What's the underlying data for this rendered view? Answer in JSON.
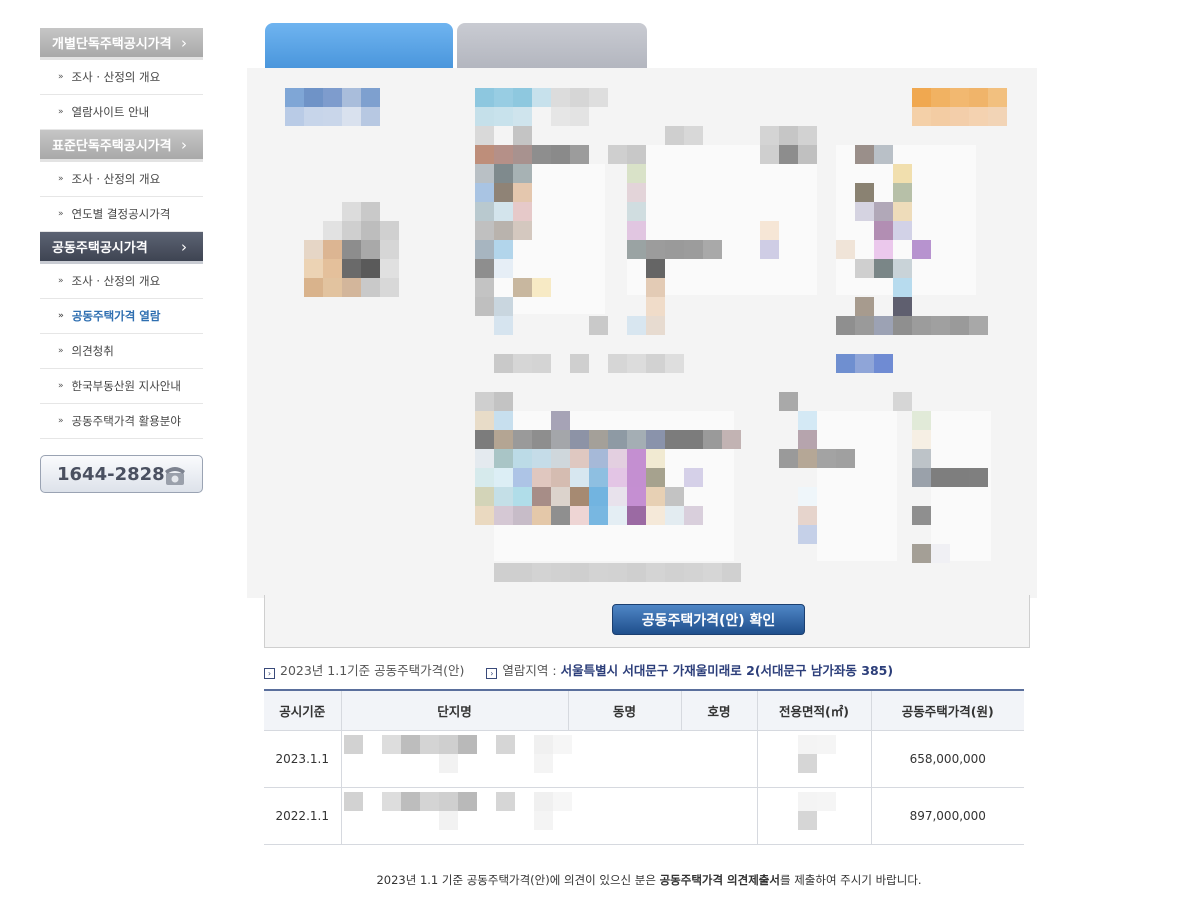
{
  "sidebar": {
    "sections": [
      {
        "title": "개별단독주택공시가격",
        "items": [
          "조사 · 산정의 개요",
          "열람사이트 안내"
        ]
      },
      {
        "title": "표준단독주택공시가격",
        "items": [
          "조사 · 산정의 개요",
          "연도별 결정공시가격"
        ]
      },
      {
        "title": "공동주택공시가격",
        "items": [
          "조사 · 산정의 개요",
          "공동주택가격 열람",
          "의견청취",
          "한국부동산원 지사안내",
          "공동주택가격 활용분야"
        ]
      }
    ],
    "phone": "1644-2828"
  },
  "panel": {
    "confirm_button": "공동주택가격(안) 확인"
  },
  "info": {
    "basis": "2023년 1.1기준 공동주택가격(안)",
    "area_label": "열람지역 : ",
    "area_value": "서울특별시 서대문구 가재울미래로 2(서대문구 남가좌동 385)"
  },
  "table": {
    "headers": [
      "공시기준",
      "단지명",
      "동명",
      "호명",
      "전용면적(㎡)",
      "공동주택가격(원)"
    ],
    "rows": [
      {
        "date": "2023.1.1",
        "price": "658,000,000"
      },
      {
        "date": "2022.1.1",
        "price": "897,000,000"
      }
    ]
  },
  "footer": {
    "pre": "2023년 1.1 기준 공동주택가격(안)에 의견이 있으신 분은 ",
    "bold": "공동주택가격 의견제출서",
    "post": "를 제출하여 주시기 바랍니다."
  }
}
